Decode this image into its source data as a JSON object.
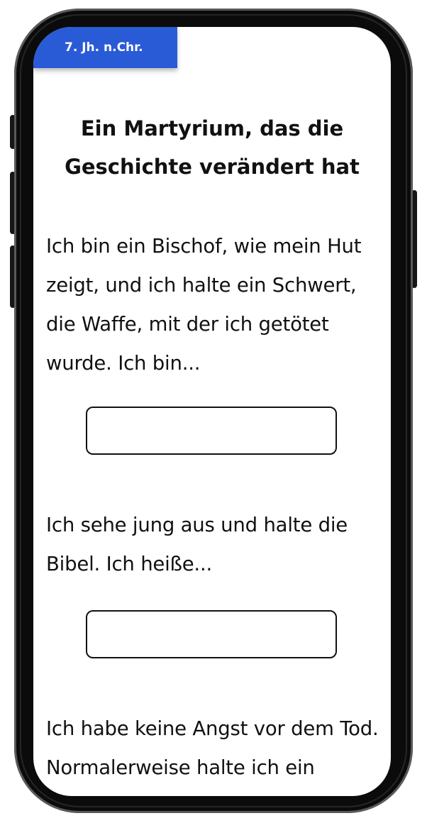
{
  "era_tag": "7. Jh. n.Chr.",
  "title": "Ein Martyrium, das die Geschichte verändert hat",
  "questions": [
    {
      "text": "Ich bin ein Bischof, wie mein Hut zeigt, und ich halte ein Schwert, die Waffe, mit der ich getötet wurde. Ich bin...",
      "answer": ""
    },
    {
      "text": "Ich sehe jung aus und halte die Bibel. Ich heiße...",
      "answer": ""
    },
    {
      "text": "Ich habe keine Angst vor dem Tod. Normalerweise halte ich ein"
    }
  ],
  "colors": {
    "tag_background": "#2a5bd7",
    "frame": "#0b0b0b",
    "text": "#111111"
  }
}
